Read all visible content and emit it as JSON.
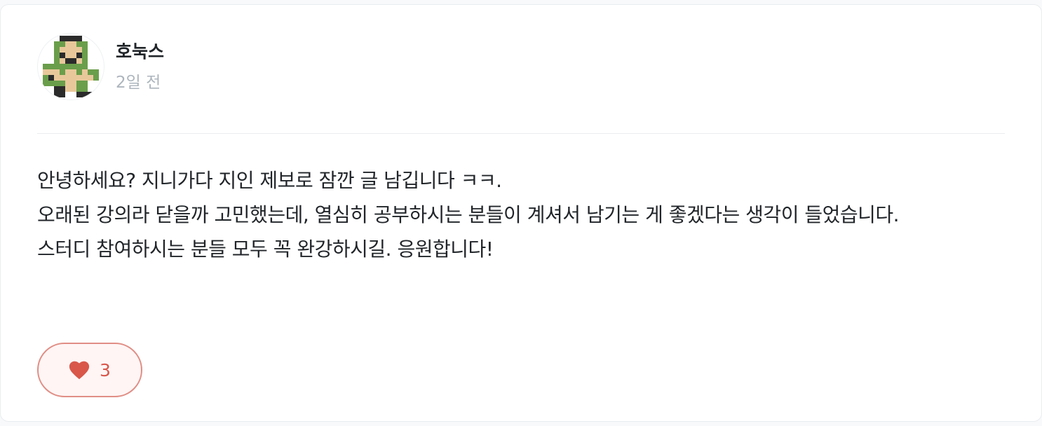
{
  "comment": {
    "author": "호눅스",
    "date": "2일 전",
    "avatar_icon": "pixel-knight-avatar",
    "lines": [
      "안녕하세요? 지니가다 지인 제보로 잠깐 글 남깁니다 ㅋㅋ.",
      "오래된 강의라 닫을까 고민했는데, 열심히 공부하시는 분들이 계셔서 남기는 게 좋겠다는 생각이 들었습니다.",
      "스터디 참여하시는 분들 모두 꼭 완강하시길. 응원합니다!"
    ],
    "likes": {
      "icon": "heart-icon",
      "count": "3",
      "color": "#d8574a"
    }
  }
}
